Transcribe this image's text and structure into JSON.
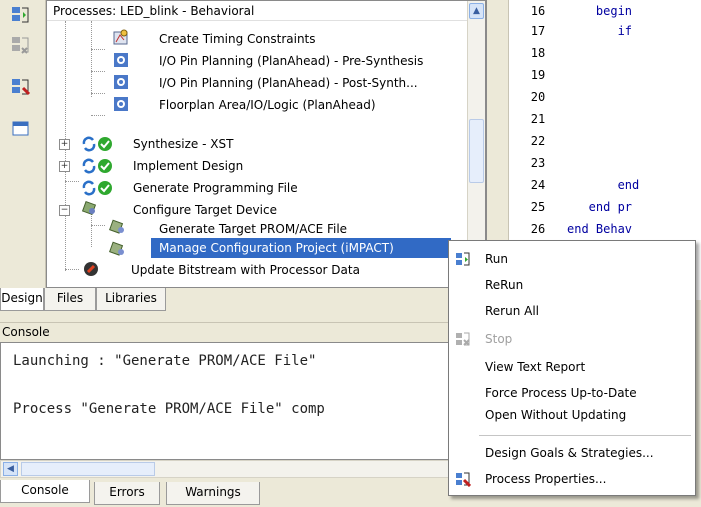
{
  "processes": {
    "title": "Processes: LED_blink - Behavioral",
    "items": [
      {
        "label": "Create Timing Constraints",
        "icon": "timing-icon"
      },
      {
        "label": "I/O Pin Planning (PlanAhead) - Pre-Synthesis",
        "icon": "planahead-icon"
      },
      {
        "label": "I/O Pin Planning (PlanAhead) - Post-Synth...",
        "icon": "planahead-icon"
      },
      {
        "label": "Floorplan Area/IO/Logic (PlanAhead)",
        "icon": "planahead-icon"
      },
      {
        "label": "Synthesize - XST",
        "icon": "check-ok-icon"
      },
      {
        "label": "Implement Design",
        "icon": "check-ok-icon"
      },
      {
        "label": "Generate Programming File",
        "icon": "check-ok-icon"
      },
      {
        "label": "Configure Target Device",
        "icon": "device-icon"
      },
      {
        "label": "Generate Target PROM/ACE File",
        "icon": "prom-icon"
      },
      {
        "label": "Manage Configuration Project (iMPACT)",
        "icon": "impact-icon"
      },
      {
        "label": "Update Bitstream with Processor Data",
        "icon": "bitstream-icon"
      }
    ]
  },
  "design_tabs": [
    "Design",
    "Files",
    "Libraries"
  ],
  "code": {
    "lines": [
      {
        "num": "16",
        "text": "    begin"
      },
      {
        "num": "17",
        "text": "       if"
      },
      {
        "num": "18",
        "text": ""
      },
      {
        "num": "19",
        "text": ""
      },
      {
        "num": "20",
        "text": ""
      },
      {
        "num": "21",
        "text": ""
      },
      {
        "num": "22",
        "text": ""
      },
      {
        "num": "23",
        "text": ""
      },
      {
        "num": "24",
        "text": "       end"
      },
      {
        "num": "25",
        "text": "   end pr"
      },
      {
        "num": "26",
        "text": "end Behav"
      }
    ]
  },
  "console": {
    "title": "Console",
    "lines": [
      "Launching : \"Generate PROM/ACE File\"",
      "Process \"Generate PROM/ACE File\" comp"
    ]
  },
  "console_tabs": [
    "Console",
    "Errors",
    "Warnings"
  ],
  "context_menu": {
    "items": [
      {
        "label": "Run",
        "disabled": false,
        "icon": "run-icon"
      },
      {
        "label": "ReRun",
        "disabled": false
      },
      {
        "label": "Rerun All",
        "disabled": false
      },
      {
        "label": "Stop",
        "disabled": true,
        "icon": "stop-icon"
      },
      {
        "label": "View Text Report",
        "disabled": false
      },
      {
        "label": "Force Process Up-to-Date",
        "disabled": false
      },
      {
        "label": "Open Without Updating",
        "disabled": false
      },
      {
        "label": "Design Goals & Strategies...",
        "disabled": false
      },
      {
        "label": "Process Properties...",
        "disabled": false,
        "icon": "properties-icon"
      }
    ]
  },
  "colors": {
    "selection": "#316ac5",
    "chrome": "#ece9d8",
    "code_keyword": "#0000a0",
    "check_green": "#2fa82f"
  }
}
